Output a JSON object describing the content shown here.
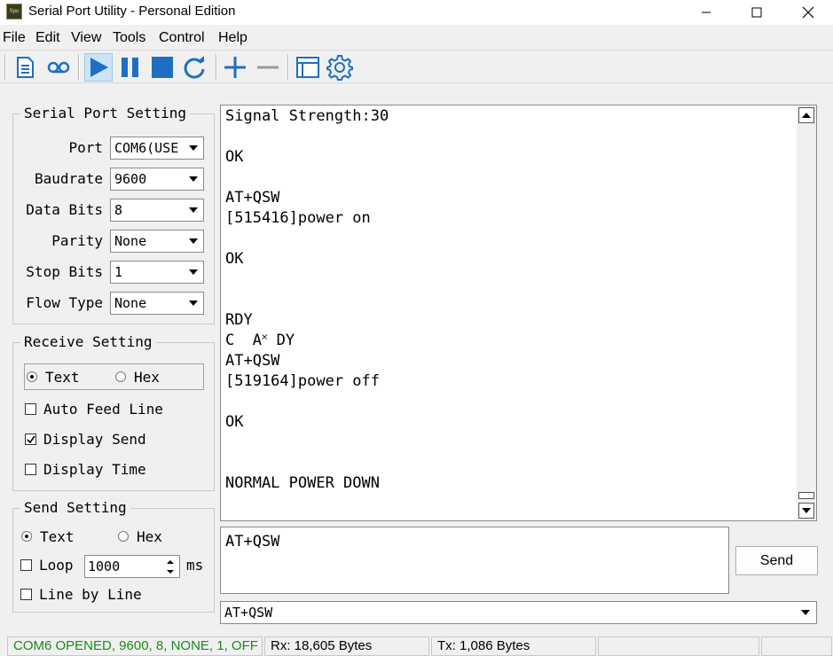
{
  "window": {
    "title": "Serial Port Utility - Personal Edition",
    "app_icon_text": "Spu"
  },
  "menu": {
    "items": [
      "File",
      "Edit",
      "View",
      "Tools",
      "Control",
      "Help"
    ]
  },
  "toolbar": {
    "icons": [
      "new-document-icon",
      "record-icon",
      "play-icon",
      "pause-icon",
      "stop-icon",
      "refresh-icon",
      "add-icon",
      "remove-icon",
      "window-icon",
      "settings-gear-icon"
    ],
    "accent_color": "#1e6fc1"
  },
  "serial_port_setting": {
    "title": "Serial Port Setting",
    "port_label": "Port",
    "port_value": "COM6(USE",
    "baudrate_label": "Baudrate",
    "baudrate_value": "9600",
    "data_bits_label": "Data Bits",
    "data_bits_value": "8",
    "parity_label": "Parity",
    "parity_value": "None",
    "stop_bits_label": "Stop Bits",
    "stop_bits_value": "1",
    "flow_type_label": "Flow Type",
    "flow_type_value": "None"
  },
  "receive_setting": {
    "title": "Receive Setting",
    "mode_text_label": "Text",
    "mode_hex_label": "Hex",
    "selected_mode": "Text",
    "auto_feed_line_label": "Auto Feed Line",
    "auto_feed_line_checked": false,
    "display_send_label": "Display Send",
    "display_send_checked": true,
    "display_time_label": "Display Time",
    "display_time_checked": false
  },
  "send_setting": {
    "title": "Send Setting",
    "mode_text_label": "Text",
    "mode_hex_label": "Hex",
    "selected_mode": "Text",
    "loop_label": "Loop",
    "loop_checked": false,
    "loop_interval": "1000",
    "loop_unit": "ms",
    "line_by_line_label": "Line by Line",
    "line_by_line_checked": false
  },
  "receive_log": {
    "lines": [
      "Signal Strength:30",
      "",
      "OK",
      "",
      "AT+QSW",
      "[515416]power on",
      "",
      "OK",
      "",
      "",
      "RDY",
      "C  A˟ DY",
      "AT+QSW",
      "[519164]power off",
      "",
      "OK",
      "",
      "",
      "NORMAL POWER DOWN"
    ]
  },
  "send_box": {
    "text": "AT+QSW",
    "send_button_label": "Send",
    "history_value": "AT+QSW"
  },
  "status": {
    "connection": "COM6 OPENED, 9600, 8, NONE, 1, OFF",
    "connection_color": "#1a8a1a",
    "rx": "Rx: 18,605 Bytes",
    "tx": "Tx: 1,086 Bytes"
  }
}
